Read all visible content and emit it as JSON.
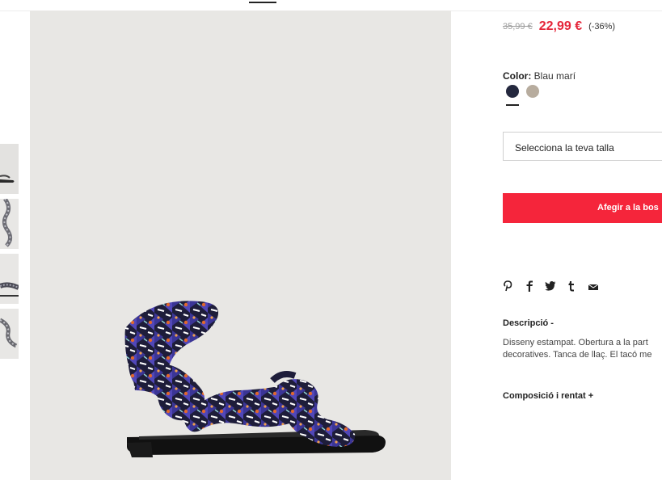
{
  "price": {
    "old": "35,99 €",
    "current": "22,99 €",
    "discount": "(-36%)"
  },
  "color": {
    "label": "Color:",
    "value": "Blau marí",
    "swatches": [
      {
        "name": "navy",
        "hex": "#24283e",
        "selected": true
      },
      {
        "name": "beige",
        "hex": "#b7ac9e",
        "selected": false
      }
    ]
  },
  "size_select": {
    "placeholder": "Selecciona la teva talla"
  },
  "add_to_bag": {
    "label": "Afegir a la bos"
  },
  "share": {
    "icons": [
      "pinterest-icon",
      "facebook-icon",
      "twitter-icon",
      "tumblr-icon",
      "email-icon"
    ]
  },
  "description": {
    "title": "Descripció  -",
    "line1": "Disseny estampat. Obertura a la part",
    "line2": "decoratives. Tanca de llaç. El tacó me"
  },
  "composition": {
    "title": "Composició i rentat  +"
  },
  "colors": {
    "accent": "#f5253b",
    "price_red": "#e5263a",
    "image_bg": "#e8e7e4"
  }
}
